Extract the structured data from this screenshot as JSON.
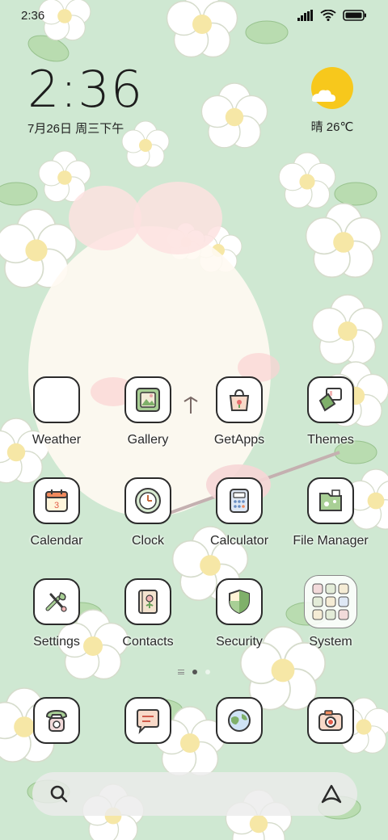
{
  "status_bar": {
    "time": "2:36"
  },
  "clock_widget": {
    "time": "2:36",
    "date": "7月26日 周三下午"
  },
  "weather_widget": {
    "text": "晴 26℃"
  },
  "apps": [
    {
      "label": "Weather",
      "icon": "weather-icon"
    },
    {
      "label": "Gallery",
      "icon": "gallery-icon"
    },
    {
      "label": "GetApps",
      "icon": "getapps-icon"
    },
    {
      "label": "Themes",
      "icon": "themes-icon"
    },
    {
      "label": "Calendar",
      "icon": "calendar-icon"
    },
    {
      "label": "Clock",
      "icon": "clock-icon"
    },
    {
      "label": "Calculator",
      "icon": "calculator-icon"
    },
    {
      "label": "File Manager",
      "icon": "file-manager-icon"
    },
    {
      "label": "Settings",
      "icon": "settings-icon"
    },
    {
      "label": "Contacts",
      "icon": "contacts-icon"
    },
    {
      "label": "Security",
      "icon": "security-icon"
    },
    {
      "label": "System",
      "icon": "system-folder-icon"
    }
  ],
  "dock": [
    {
      "icon": "phone-icon"
    },
    {
      "icon": "messages-icon"
    },
    {
      "icon": "browser-icon"
    },
    {
      "icon": "camera-icon"
    }
  ],
  "calendar_icon_day": "3",
  "page_indicator": {
    "pages": 2,
    "active": 1
  },
  "colors": {
    "accent_green": "#9cc79a",
    "sun": "#f7c81c",
    "icon_border": "#2b2b2b"
  }
}
